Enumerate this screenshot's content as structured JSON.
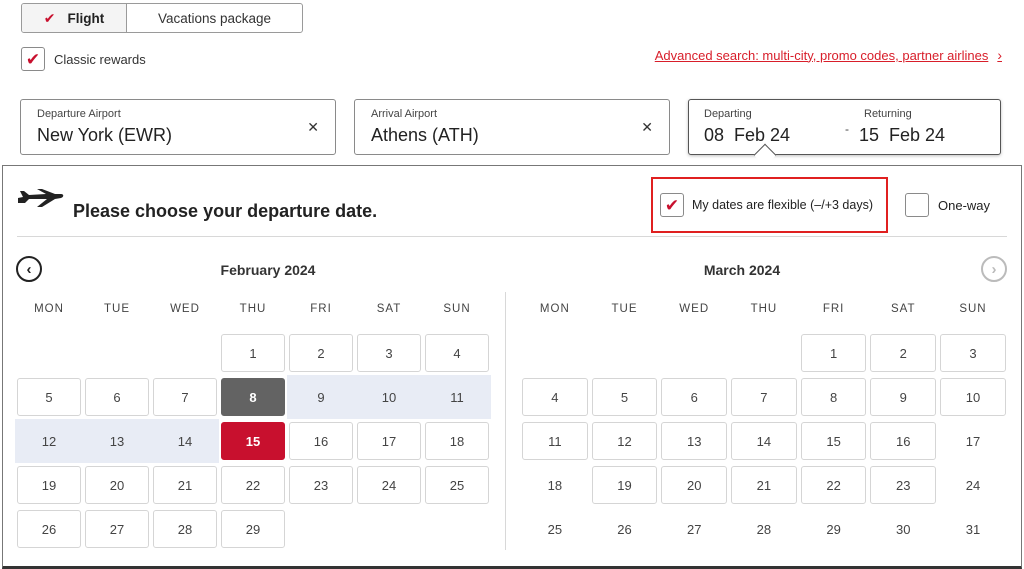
{
  "trip_tabs": {
    "flight": "Flight",
    "vacations": "Vacations package"
  },
  "classic_rewards": {
    "label": "Classic rewards",
    "checked": true
  },
  "advanced_search": {
    "label": "Advanced search: multi-city, promo codes, partner airlines"
  },
  "departure_airport": {
    "label": "Departure Airport",
    "value": "New York (EWR)"
  },
  "arrival_airport": {
    "label": "Arrival Airport",
    "value": "Athens (ATH)"
  },
  "dates": {
    "departing_label": "Departing",
    "departing_value": "08  Feb 24",
    "returning_label": "Returning",
    "returning_value": "15  Feb 24",
    "separator": "-"
  },
  "panel": {
    "title": "Please choose your departure date.",
    "flexible_label": "My dates are flexible (–/+3 days)",
    "flexible_checked": true,
    "oneway_label": "One-way",
    "oneway_checked": false
  },
  "calendar": {
    "weekdays": [
      "MON",
      "TUE",
      "WED",
      "THU",
      "FRI",
      "SAT",
      "SUN"
    ],
    "months": [
      {
        "title": "February 2024",
        "weeks": [
          [
            "",
            "",
            "",
            "1",
            "2",
            "3",
            "4"
          ],
          [
            "5",
            "6",
            "7",
            "8",
            "9",
            "10",
            "11"
          ],
          [
            "12",
            "13",
            "14",
            "15",
            "16",
            "17",
            "18"
          ],
          [
            "19",
            "20",
            "21",
            "22",
            "23",
            "24",
            "25"
          ],
          [
            "26",
            "27",
            "28",
            "29",
            "",
            "",
            ""
          ]
        ],
        "start_day": "8",
        "end_day": "15",
        "range_days": [
          "9",
          "10",
          "11",
          "12",
          "13",
          "14"
        ]
      },
      {
        "title": "March 2024",
        "weeks": [
          [
            "",
            "",
            "",
            "",
            "1",
            "2",
            "3"
          ],
          [
            "4",
            "5",
            "6",
            "7",
            "8",
            "9",
            "10"
          ],
          [
            "11",
            "12",
            "13",
            "14",
            "15",
            "16",
            "17"
          ],
          [
            "18",
            "19",
            "20",
            "21",
            "22",
            "23",
            "24"
          ],
          [
            "25",
            "26",
            "27",
            "28",
            "29",
            "30",
            "31"
          ]
        ],
        "plain_days": [
          "17",
          "18",
          "24",
          "25",
          "26",
          "27",
          "28",
          "29",
          "30",
          "31"
        ]
      }
    ]
  },
  "colors": {
    "accent": "#c8102e",
    "highlight_box": "#e02020",
    "range_bg": "#e8ecf5",
    "start_bg": "#636363"
  },
  "icons": {
    "plane": "plane-icon",
    "prev": "chevron-left-icon",
    "next": "chevron-right-icon",
    "clear": "close-icon",
    "check": "check-icon"
  }
}
